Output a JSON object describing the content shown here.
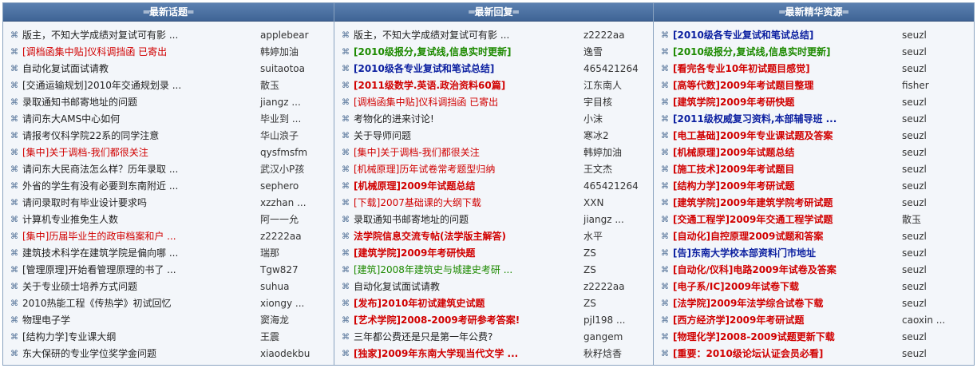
{
  "columns": [
    {
      "header": "═最新话题═",
      "rows": [
        {
          "title": "版主，不知大学成绩对复试可有影 ...",
          "author": "applebear",
          "color": "black",
          "bold": false
        },
        {
          "title": "[调档函集中贴]仪科调挡函  已寄出",
          "author": "韩婷加油",
          "color": "red",
          "bold": false
        },
        {
          "title": "自动化复试面试请教",
          "author": "suitaotoa",
          "color": "black",
          "bold": false
        },
        {
          "title": "[交通运输规划]2010年交通规划录 ...",
          "author": "散玉",
          "color": "black",
          "bold": false
        },
        {
          "title": "录取通知书邮寄地址的问题",
          "author": "jiangz ...",
          "color": "black",
          "bold": false
        },
        {
          "title": "请问东大AMS中心如何",
          "author": "毕业到 ...",
          "color": "black",
          "bold": false
        },
        {
          "title": "请报考仪科学院22系的同学注意",
          "author": "华山浪子",
          "color": "black",
          "bold": false
        },
        {
          "title": "[集中]关于调档-我们都很关注",
          "author": "qysfmsfm",
          "color": "red",
          "bold": false
        },
        {
          "title": "请问东大民商法怎么样？历年录取 ...",
          "author": "武汉小P孩",
          "color": "black",
          "bold": false
        },
        {
          "title": "外省的学生有没有必要到东南附近 ...",
          "author": "sephero",
          "color": "black",
          "bold": false
        },
        {
          "title": "请问录取时有毕业设计要求吗",
          "author": "xzzhan ...",
          "color": "black",
          "bold": false
        },
        {
          "title": "计算机专业推免生人数",
          "author": "阿一一允",
          "color": "black",
          "bold": false
        },
        {
          "title": "[集中]历届毕业生的政审档案和户 ...",
          "author": "z2222aa",
          "color": "red",
          "bold": false
        },
        {
          "title": "建筑技术科学在建筑学院是偏向哪 ...",
          "author": "瑞那",
          "color": "black",
          "bold": false
        },
        {
          "title": "[管理原理]开始看管理原理的书了 ...",
          "author": "Tgw827",
          "color": "black",
          "bold": false
        },
        {
          "title": "关于专业硕士培养方式问题",
          "author": "suhua",
          "color": "black",
          "bold": false
        },
        {
          "title": "2010热能工程《传热学》初试回忆",
          "author": "xiongy ...",
          "color": "black",
          "bold": false
        },
        {
          "title": "物理电子学",
          "author": "窦海龙",
          "color": "black",
          "bold": false
        },
        {
          "title": "[结构力学]专业课大纲",
          "author": "王震",
          "color": "black",
          "bold": false
        },
        {
          "title": "东大保研的专业学位奖学金问题",
          "author": "xiaodekbu",
          "color": "black",
          "bold": false
        }
      ]
    },
    {
      "header": "═最新回复═",
      "rows": [
        {
          "title": "版主，不知大学成绩对复试可有影 ...",
          "author": "z2222aa",
          "color": "black",
          "bold": false
        },
        {
          "title": "[2010级报分,复试线,信息实时更新]",
          "author": "逸雪",
          "color": "green",
          "bold": true
        },
        {
          "title": "[2010级各专业复试和笔试总结]",
          "author": "465421264",
          "color": "blue",
          "bold": true
        },
        {
          "title": "[2011级数学.英语.政治资料60篇]",
          "author": "江东南人",
          "color": "red",
          "bold": true
        },
        {
          "title": "[调档函集中贴]仪科调挡函  已寄出",
          "author": "宇目核",
          "color": "red",
          "bold": false
        },
        {
          "title": "考物化的进来讨论!",
          "author": "小沫",
          "color": "black",
          "bold": false
        },
        {
          "title": "关于导师问题",
          "author": "寒冰2",
          "color": "black",
          "bold": false
        },
        {
          "title": "[集中]关于调档-我们都很关注",
          "author": "韩婷加油",
          "color": "red",
          "bold": false
        },
        {
          "title": "[机械原理]历年试卷常考题型归纳",
          "author": "王文杰",
          "color": "red",
          "bold": false
        },
        {
          "title": "[机械原理]2009年试题总结",
          "author": "465421264",
          "color": "red",
          "bold": true
        },
        {
          "title": "[下载]2007基础课的大纲下载",
          "author": "XXN",
          "color": "red",
          "bold": false
        },
        {
          "title": "录取通知书邮寄地址的问题",
          "author": "jiangz ...",
          "color": "black",
          "bold": false
        },
        {
          "title": "法学院信息交流专帖(法学版主解答)",
          "author": "水平",
          "color": "red",
          "bold": true
        },
        {
          "title": "[建筑学院]2009年考研快题",
          "author": "ZS",
          "color": "red",
          "bold": true
        },
        {
          "title": "[建筑]2008年建筑史与城建史考研 ...",
          "author": "ZS",
          "color": "green",
          "bold": false
        },
        {
          "title": "自动化复试面试请教",
          "author": "z2222aa",
          "color": "black",
          "bold": false
        },
        {
          "title": "[发布]2010年初试建筑史试题",
          "author": "ZS",
          "color": "red",
          "bold": true
        },
        {
          "title": "[艺术学院]2008-2009考研参考答案!",
          "author": "pjl198 ...",
          "color": "red",
          "bold": true
        },
        {
          "title": "三年都公费还是只是第一年公费?",
          "author": "gangem",
          "color": "black",
          "bold": false
        },
        {
          "title": "[独家]2009年东南大学现当代文学 ...",
          "author": "秋籽焓香",
          "color": "red",
          "bold": true
        }
      ]
    },
    {
      "header": "═最新精华资源═",
      "rows": [
        {
          "title": "[2010级各专业复试和笔试总结]",
          "author": "seuzl",
          "color": "blue",
          "bold": true
        },
        {
          "title": "[2010级报分,复试线,信息实时更新]",
          "author": "seuzl",
          "color": "green",
          "bold": true
        },
        {
          "title": "[看完各专业10年初试题目感觉]",
          "author": "seuzl",
          "color": "red",
          "bold": true
        },
        {
          "title": "[高等代数]2009年考试题目整理",
          "author": "fisher",
          "color": "red",
          "bold": true
        },
        {
          "title": "[建筑学院]2009年考研快题",
          "author": "seuzl",
          "color": "red",
          "bold": true
        },
        {
          "title": "[2011级权威复习资料,本部辅导班 ...",
          "author": "seuzl",
          "color": "blue",
          "bold": true
        },
        {
          "title": "[电工基础]2009年专业课试题及答案",
          "author": "seuzl",
          "color": "red",
          "bold": true
        },
        {
          "title": "[机械原理]2009年试题总结",
          "author": "seuzl",
          "color": "red",
          "bold": true
        },
        {
          "title": "[施工技术]2009年考试题目",
          "author": "seuzl",
          "color": "red",
          "bold": true
        },
        {
          "title": "[结构力学]2009年考研试题",
          "author": "seuzl",
          "color": "red",
          "bold": true
        },
        {
          "title": "[建筑学院]2009年建筑学院考研试题",
          "author": "seuzl",
          "color": "red",
          "bold": true
        },
        {
          "title": "[交通工程学]2009年交通工程学试题",
          "author": "散玉",
          "color": "red",
          "bold": true
        },
        {
          "title": "[自动化]自控原理2009试题和答案",
          "author": "seuzl",
          "color": "red",
          "bold": true
        },
        {
          "title": "[告]东南大学校本部资料门市地址",
          "author": "seuzl",
          "color": "blue",
          "bold": true
        },
        {
          "title": "[自动化/仪科]电路2009年试卷及答案",
          "author": "seuzl",
          "color": "red",
          "bold": true
        },
        {
          "title": "[电子系/IC]2009年试卷下载",
          "author": "seuzl",
          "color": "red",
          "bold": true
        },
        {
          "title": "[法学院]2009年法学综合试卷下载",
          "author": "seuzl",
          "color": "red",
          "bold": true
        },
        {
          "title": "[西方经济学]2009年考研试题",
          "author": "caoxin ...",
          "color": "red",
          "bold": true
        },
        {
          "title": "[物理化学]2008-2009试题更新下载",
          "author": "seuzl",
          "color": "red",
          "bold": true
        },
        {
          "title": "[重要：2010级论坛认证会员必看]",
          "author": "seuzl",
          "color": "red",
          "bold": true
        }
      ]
    }
  ]
}
